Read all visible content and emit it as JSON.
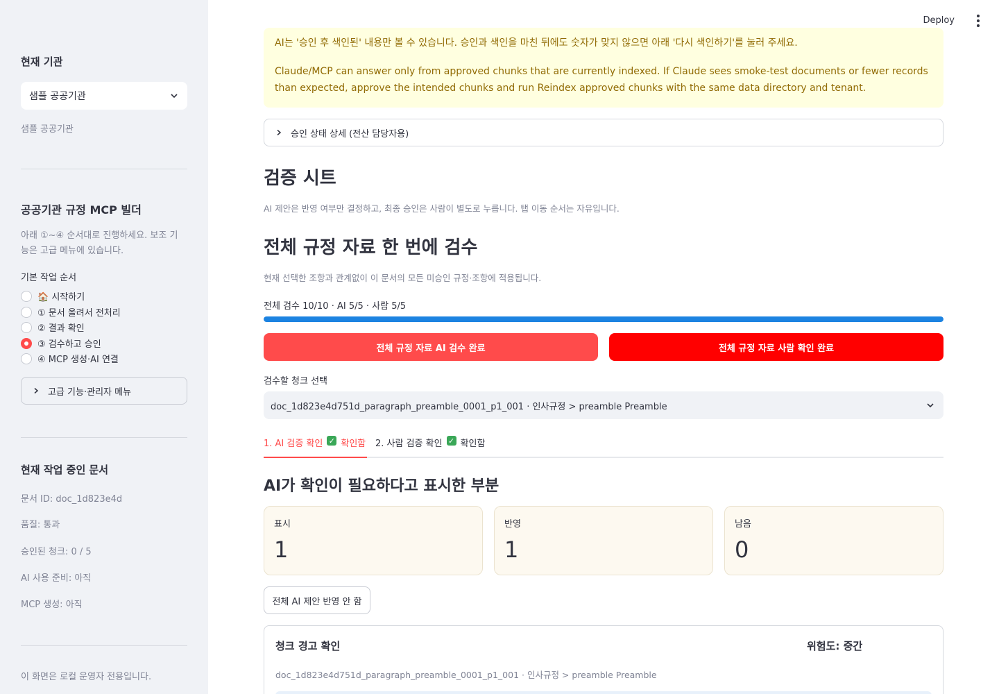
{
  "topbar": {
    "deploy_label": "Deploy"
  },
  "sidebar": {
    "org_heading": "현재 기관",
    "org_select_value": "샘플 공공기관",
    "org_caption": "샘플 공공기관",
    "builder_heading": "공공기관 규정 MCP 빌더",
    "builder_desc_line1": "아래 ①~④ 순서대로 진행하세요. 보조 기",
    "builder_desc_line2": "능은 고급 메뉴에 있습니다.",
    "steps_label": "기본 작업 순서",
    "steps": [
      {
        "label": "🏠 시작하기",
        "selected": false
      },
      {
        "label": "① 문서 올려서 전처리",
        "selected": false
      },
      {
        "label": "② 결과 확인",
        "selected": false
      },
      {
        "label": "③ 검수하고 승인",
        "selected": true
      },
      {
        "label": "④ MCP 생성·AI 연결",
        "selected": false
      }
    ],
    "advanced_label": "고급 기능·관리자 메뉴",
    "doc_heading": "현재 작업 중인 문서",
    "doc_id": "문서 ID: doc_1d823e4d",
    "quality": "품질: 통과",
    "approved_chunks": "승인된 청크: 0 / 5",
    "ai_ready": "AI 사용 준비: 아직",
    "mcp_created": "MCP 생성: 아직",
    "footer_note": "이 화면은 로컬 운영자 전용입니다."
  },
  "main": {
    "warning_cut_text": "AI는 '승인 후 색인된' 내용만 볼 수 있습니다. 승인과 색인을 마친 뒤에도 숫자가 맞지 않으면 아래 '다시 색인하기'를 눌러 주세요.",
    "warning_text": "Claude/MCP can answer only from approved chunks that are currently indexed. If Claude sees smoke-test documents or fewer records than expected, approve the intended chunks and run Reindex approved chunks with the same data directory and tenant.",
    "approval_expander": "승인 상태 상세 (전산 담당자용)",
    "sheet_title": "검증 시트",
    "sheet_caption": "AI 제안은 반영 여부만 결정하고, 최종 승인은 사람이 별도로 누릅니다. 탭 이동 순서는 자유입니다.",
    "bulk_title": "전체 규정 자료 한 번에 검수",
    "bulk_caption": "현재 선택한 조항과 관계없이 이 문서의 모든 미승인 규정·조항에 적용됩니다.",
    "progress_label": "전체 검수 10/10 · AI 5/5 · 사람 5/5",
    "progress_fraction": 1.0,
    "btn_ai_done": "전체 규정 자료 AI 검수 완료",
    "btn_human_done": "전체 규정 자료 사람 확인 완료",
    "chunk_select_label": "검수할 청크 선택",
    "chunk_select_value": "doc_1d823e4d751d_paragraph_preamble_0001_p1_001 · 인사규정 > preamble Preamble",
    "tabs": [
      {
        "label": "1. AI 검증 확인",
        "status": "확인함",
        "active": true
      },
      {
        "label": "2. 사람 검증 확인",
        "status": "확인함",
        "active": false
      }
    ],
    "ai_flag_title": "AI가 확인이 필요하다고 표시한 부분",
    "metrics": [
      {
        "label": "표시",
        "value": "1"
      },
      {
        "label": "반영",
        "value": "1"
      },
      {
        "label": "남음",
        "value": "0"
      }
    ],
    "btn_reject_all": "전체 AI 제안 반영 안 함",
    "card_title": "청크 경고 확인",
    "card_risk": "위험도: 중간",
    "card_sub": "doc_1d823e4d751d_paragraph_preamble_0001_p1_001 · 인사규정 > preamble Preamble"
  },
  "colors": {
    "accent": "#ff4b4b",
    "primary_button": "#ff0000",
    "progress": "#1c83e1",
    "warning_bg": "#ffffe0"
  }
}
